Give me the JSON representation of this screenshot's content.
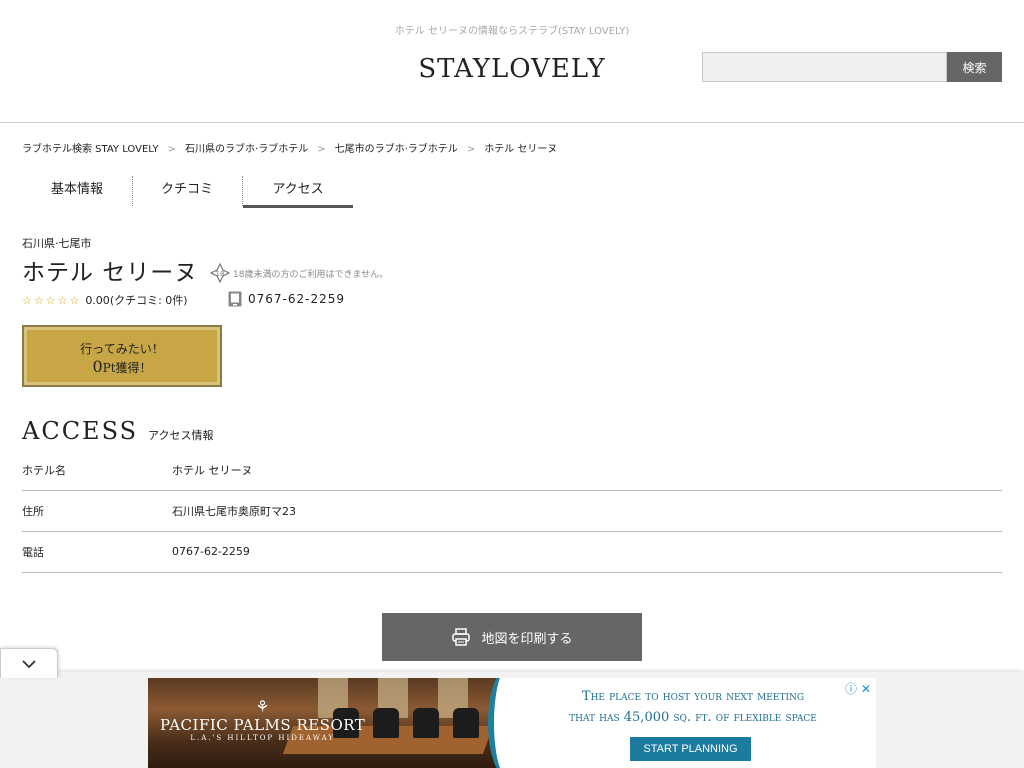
{
  "header": {
    "tagline": "ホテル セリーヌの情報ならステラブ(STAY LOVELY)",
    "logo_text": "STAYLOVELY",
    "search": {
      "placeholder": "",
      "button_label": "検索"
    }
  },
  "breadcrumb": [
    {
      "label": "ラブホテル検索 STAY LOVELY"
    },
    {
      "label": "石川県のラブホ·ラブホテル"
    },
    {
      "label": "七尾市のラブホ·ラブホテル"
    },
    {
      "label": "ホテル セリーヌ"
    }
  ],
  "breadcrumb_sep": ">",
  "tabs": [
    {
      "label": "基本情報",
      "active": false
    },
    {
      "label": "クチコミ",
      "active": false
    },
    {
      "label": "アクセス",
      "active": true
    }
  ],
  "hotel": {
    "area": "石川県·七尾市",
    "name": "ホテル セリーヌ",
    "age_note": "18歳未満の方のご利用はできません。",
    "rating_score": "0.00",
    "review_text": "(クチコミ: 0件)",
    "stars": "☆☆☆☆☆",
    "phone": "0767-62-2259"
  },
  "wish_button": {
    "line1": "行ってみたい！",
    "points": "0",
    "pt_unit": "Pt",
    "line2_suffix": "獲得！"
  },
  "access": {
    "title": "ACCESS",
    "subtitle": "アクセス情報",
    "rows": [
      {
        "key": "ホテル名",
        "value": "ホテル セリーヌ"
      },
      {
        "key": "住所",
        "value": "石川県七尾市奥原町マ23"
      },
      {
        "key": "電話",
        "value": "0767-62-2259"
      }
    ]
  },
  "print_button": {
    "label": "地図を印刷する"
  },
  "ad": {
    "brand": "PACIFIC PALMS RESORT",
    "brand_sub": "L.A.'S HILLTOP HIDEAWAY",
    "headline_line1": "The place to host your next meeting",
    "headline_line2": "that has 45,000 sq. ft. of flexible space",
    "cta": "START PLANNING",
    "info_icon": "ⓘ",
    "close_icon": "✕"
  },
  "colors": {
    "button_gray": "#666666",
    "wish_gold": "#c8a646",
    "star_color": "#d9a520",
    "ad_accent": "#1e7ba0"
  }
}
